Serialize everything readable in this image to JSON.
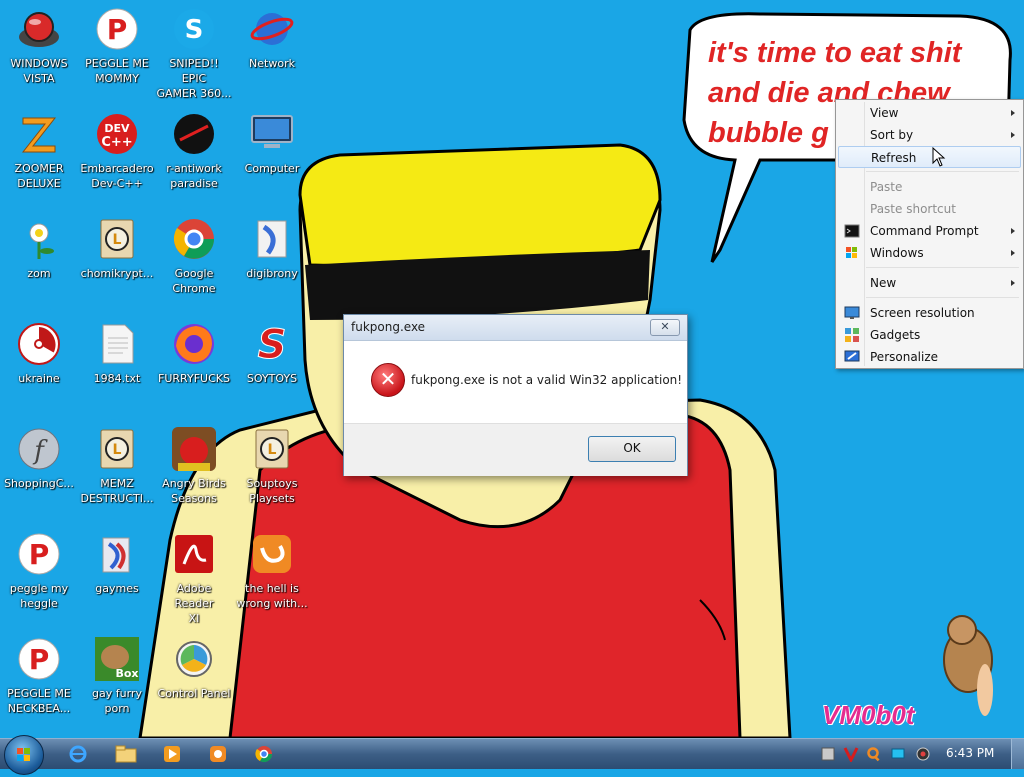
{
  "wallpaper": {
    "speech_bubble": [
      "it's time to eat shit",
      "and die and chew",
      "bubble g"
    ],
    "watermark": "VM0b0t"
  },
  "desktop_icons": [
    {
      "label": "WINDOWS\nVISTA",
      "icon": "vista-orb-icon"
    },
    {
      "label": "PEGGLE ME\nMOMMY",
      "icon": "peggle-icon"
    },
    {
      "label": "SNIPED!! EPIC\nGAMER 360...",
      "icon": "skype-icon"
    },
    {
      "label": "Network",
      "icon": "network-icon"
    },
    {
      "label": "ZOOMER\nDELUXE",
      "icon": "zoomer-icon"
    },
    {
      "label": "Embarcadero\nDev-C++",
      "icon": "devcpp-icon"
    },
    {
      "label": "r-antiwork\nparadise",
      "icon": "antiwork-icon"
    },
    {
      "label": "Computer",
      "icon": "computer-icon"
    },
    {
      "label": "zom",
      "icon": "flower-icon"
    },
    {
      "label": "chomikrypt...",
      "icon": "shortcut-l-icon"
    },
    {
      "label": "Google\nChrome",
      "icon": "chrome-icon"
    },
    {
      "label": "digibrony",
      "icon": "digibrony-icon"
    },
    {
      "label": "ukraine",
      "icon": "radiation-icon"
    },
    {
      "label": "1984.txt",
      "icon": "text-file-icon"
    },
    {
      "label": "FURRYFUCKS",
      "icon": "firefox-icon"
    },
    {
      "label": "SOYTOYS",
      "icon": "soytoys-icon"
    },
    {
      "label": "ShoppingC...",
      "icon": "flash-icon"
    },
    {
      "label": "MEMZ\nDESTRUCTI...",
      "icon": "shortcut-l-icon"
    },
    {
      "label": "Angry Birds\nSeasons",
      "icon": "angry-birds-icon"
    },
    {
      "label": "Souptoys\nPlaysets",
      "icon": "shortcut-l-icon"
    },
    {
      "label": "peggle my\nheggle",
      "icon": "peggle-icon"
    },
    {
      "label": "gaymes",
      "icon": "folder-icon"
    },
    {
      "label": "Adobe Reader\nXI",
      "icon": "adobe-reader-icon"
    },
    {
      "label": "the hell is\nwrong with...",
      "icon": "uc-browser-icon"
    },
    {
      "label": "PEGGLE ME\nNECKBEA...",
      "icon": "peggle-icon"
    },
    {
      "label": "gay furry\nporn",
      "icon": "box-beaver-icon"
    },
    {
      "label": "Control Panel",
      "icon": "control-panel-icon"
    }
  ],
  "dialog": {
    "title": "fukpong.exe",
    "close_glyph": "✕",
    "icon": "error-icon",
    "icon_glyph": "✕",
    "message": "fukpong.exe is not a valid Win32 application!",
    "ok_label": "OK"
  },
  "context_menu": {
    "items": [
      {
        "label": "View",
        "submenu": true
      },
      {
        "label": "Sort by",
        "submenu": true
      },
      {
        "label": "Refresh",
        "highlighted": true
      },
      {
        "label": "Paste",
        "disabled": true
      },
      {
        "label": "Paste shortcut",
        "disabled": true
      },
      {
        "label": "Command Prompt",
        "submenu": true,
        "icon": "command-prompt-icon"
      },
      {
        "label": "Windows",
        "submenu": true,
        "icon": "windows-flag-icon"
      },
      {
        "label": "New",
        "submenu": true
      },
      {
        "label": "Screen resolution",
        "icon": "screen-resolution-icon"
      },
      {
        "label": "Gadgets",
        "icon": "gadgets-icon"
      },
      {
        "label": "Personalize",
        "icon": "personalize-icon"
      }
    ]
  },
  "taskbar": {
    "pinned": [
      "internet-explorer-icon",
      "explorer-folder-icon",
      "media-player-icon",
      "uc-browser-icon",
      "chrome-icon"
    ],
    "tray": [
      "tray-app-icon",
      "tray-v-icon",
      "tray-search-icon",
      "tray-monitor-icon",
      "tray-volume-icon"
    ],
    "clock": "6:43 PM"
  },
  "colors": {
    "desktop_bg": "#1aa6e6",
    "bubble_text": "#e02525",
    "shirt_red": "#e0252a",
    "cap_yellow": "#f5ea14",
    "skin": "#f8efa8"
  }
}
